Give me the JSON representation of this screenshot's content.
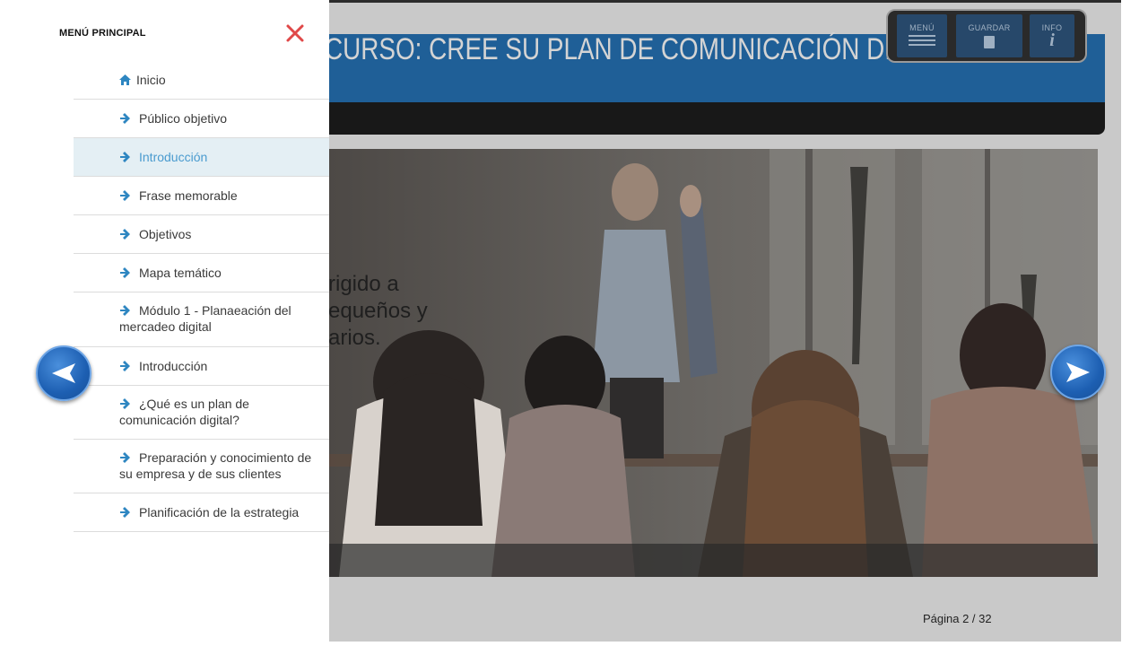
{
  "course": {
    "title": "CURSO: CREE SU PLAN DE COMUNICACIÓN DIGITAL",
    "partial_text": [
      "rigido a",
      "equeños y",
      "arios."
    ],
    "page_counter": "Página 2 / 32",
    "toolbar": {
      "menu_label": "MENÚ",
      "save_label": "GUARDAR",
      "info_label": "INFO"
    }
  },
  "menu": {
    "heading": "MENÚ PRINCIPAL",
    "items": [
      {
        "label": "Inicio",
        "icon": "home-icon"
      },
      {
        "label": "Público objetivo",
        "icon": "arrow-right-icon"
      },
      {
        "label": "Introducción",
        "icon": "arrow-right-icon",
        "active": true
      },
      {
        "label": "Frase memorable",
        "icon": "arrow-right-icon"
      },
      {
        "label": "Objetivos",
        "icon": "arrow-right-icon"
      },
      {
        "label": "Mapa temático",
        "icon": "arrow-right-icon"
      },
      {
        "label": "Módulo 1 - Planaeación del mercadeo digital",
        "icon": "arrow-right-icon"
      },
      {
        "label": "Introducción",
        "icon": "arrow-right-icon"
      },
      {
        "label": "¿Qué es un plan de comunicación digital?",
        "icon": "arrow-right-icon"
      },
      {
        "label": "Preparación y conocimiento de su empresa y de sus clientes",
        "icon": "arrow-right-icon"
      },
      {
        "label": "Planificación de la estrategia",
        "icon": "arrow-right-icon"
      }
    ]
  },
  "colors": {
    "accent_blue": "#2e86c1",
    "active_bg": "#e4eff4",
    "close_red": "#e04848",
    "title_band": "#1f5f97"
  }
}
